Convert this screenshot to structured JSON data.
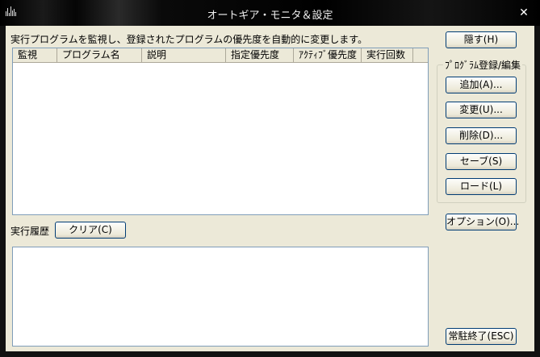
{
  "window": {
    "title": "オートギア・モニタ＆設定",
    "close_symbol": "✕"
  },
  "description": "実行プログラムを監視し、登録されたプログラムの優先度を自動的に変更します。",
  "list": {
    "columns": [
      "監視",
      "プログラム名",
      "説明",
      "指定優先度",
      "ｱｸﾃｨﾌﾞ優先度",
      "実行回数"
    ],
    "rows": []
  },
  "history": {
    "label": "実行履歴",
    "clear_button": "クリア(C)"
  },
  "buttons": {
    "hide": "隠す(H)",
    "group_label": "ﾌﾟﾛｸﾞﾗﾑ登録/編集",
    "add": "追加(A)...",
    "change": "変更(U)...",
    "delete": "削除(D)...",
    "save": "セーブ(S)",
    "load": "ロード(L)",
    "options": "オプション(O)...",
    "exit": "常駐終了(ESC)"
  }
}
